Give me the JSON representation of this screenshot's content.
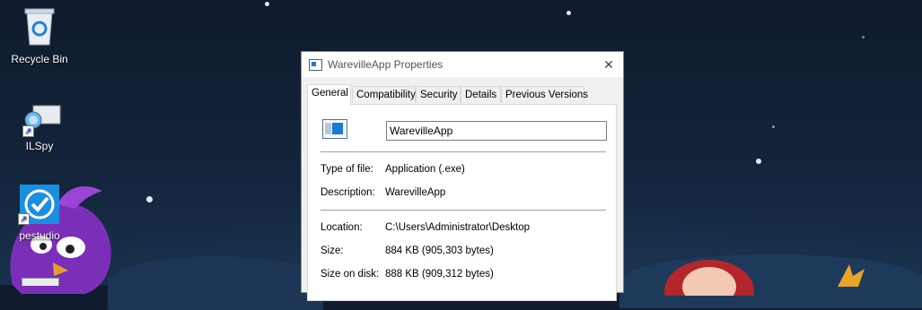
{
  "desktop": {
    "icons": [
      {
        "label": "Recycle Bin"
      },
      {
        "label": "ILSpy"
      },
      {
        "label": "pestudio"
      }
    ]
  },
  "dialog": {
    "title": "WarevilleApp Properties",
    "close_glyph": "✕",
    "tabs": [
      "General",
      "Compatibility",
      "Security",
      "Details",
      "Previous Versions"
    ],
    "active_tab": "General",
    "name_value": "WarevilleApp",
    "rows": {
      "type_label": "Type of file:",
      "type_value": "Application (.exe)",
      "description_label": "Description:",
      "description_value": "WarevilleApp",
      "location_label": "Location:",
      "location_value": "C:\\Users\\Administrator\\Desktop",
      "size_label": "Size:",
      "size_value": "884 KB (905,303 bytes)",
      "size_on_disk_label": "Size on disk:",
      "size_on_disk_value": "888 KB (909,312 bytes)"
    }
  },
  "icons": {
    "recycle_bin": "recycle-bin-icon",
    "ilspy": "ilspy-icon",
    "pestudio": "pestudio-icon",
    "app": "application-icon",
    "close": "close-icon"
  },
  "colors": {
    "sky_top": "#0f1b2c",
    "sky_bottom": "#17304b",
    "dialog_bg": "#f0f0f0",
    "panel_bg": "#ffffff",
    "accent_blue": "#1a78d6",
    "bird_purple": "#7b2fb8"
  }
}
